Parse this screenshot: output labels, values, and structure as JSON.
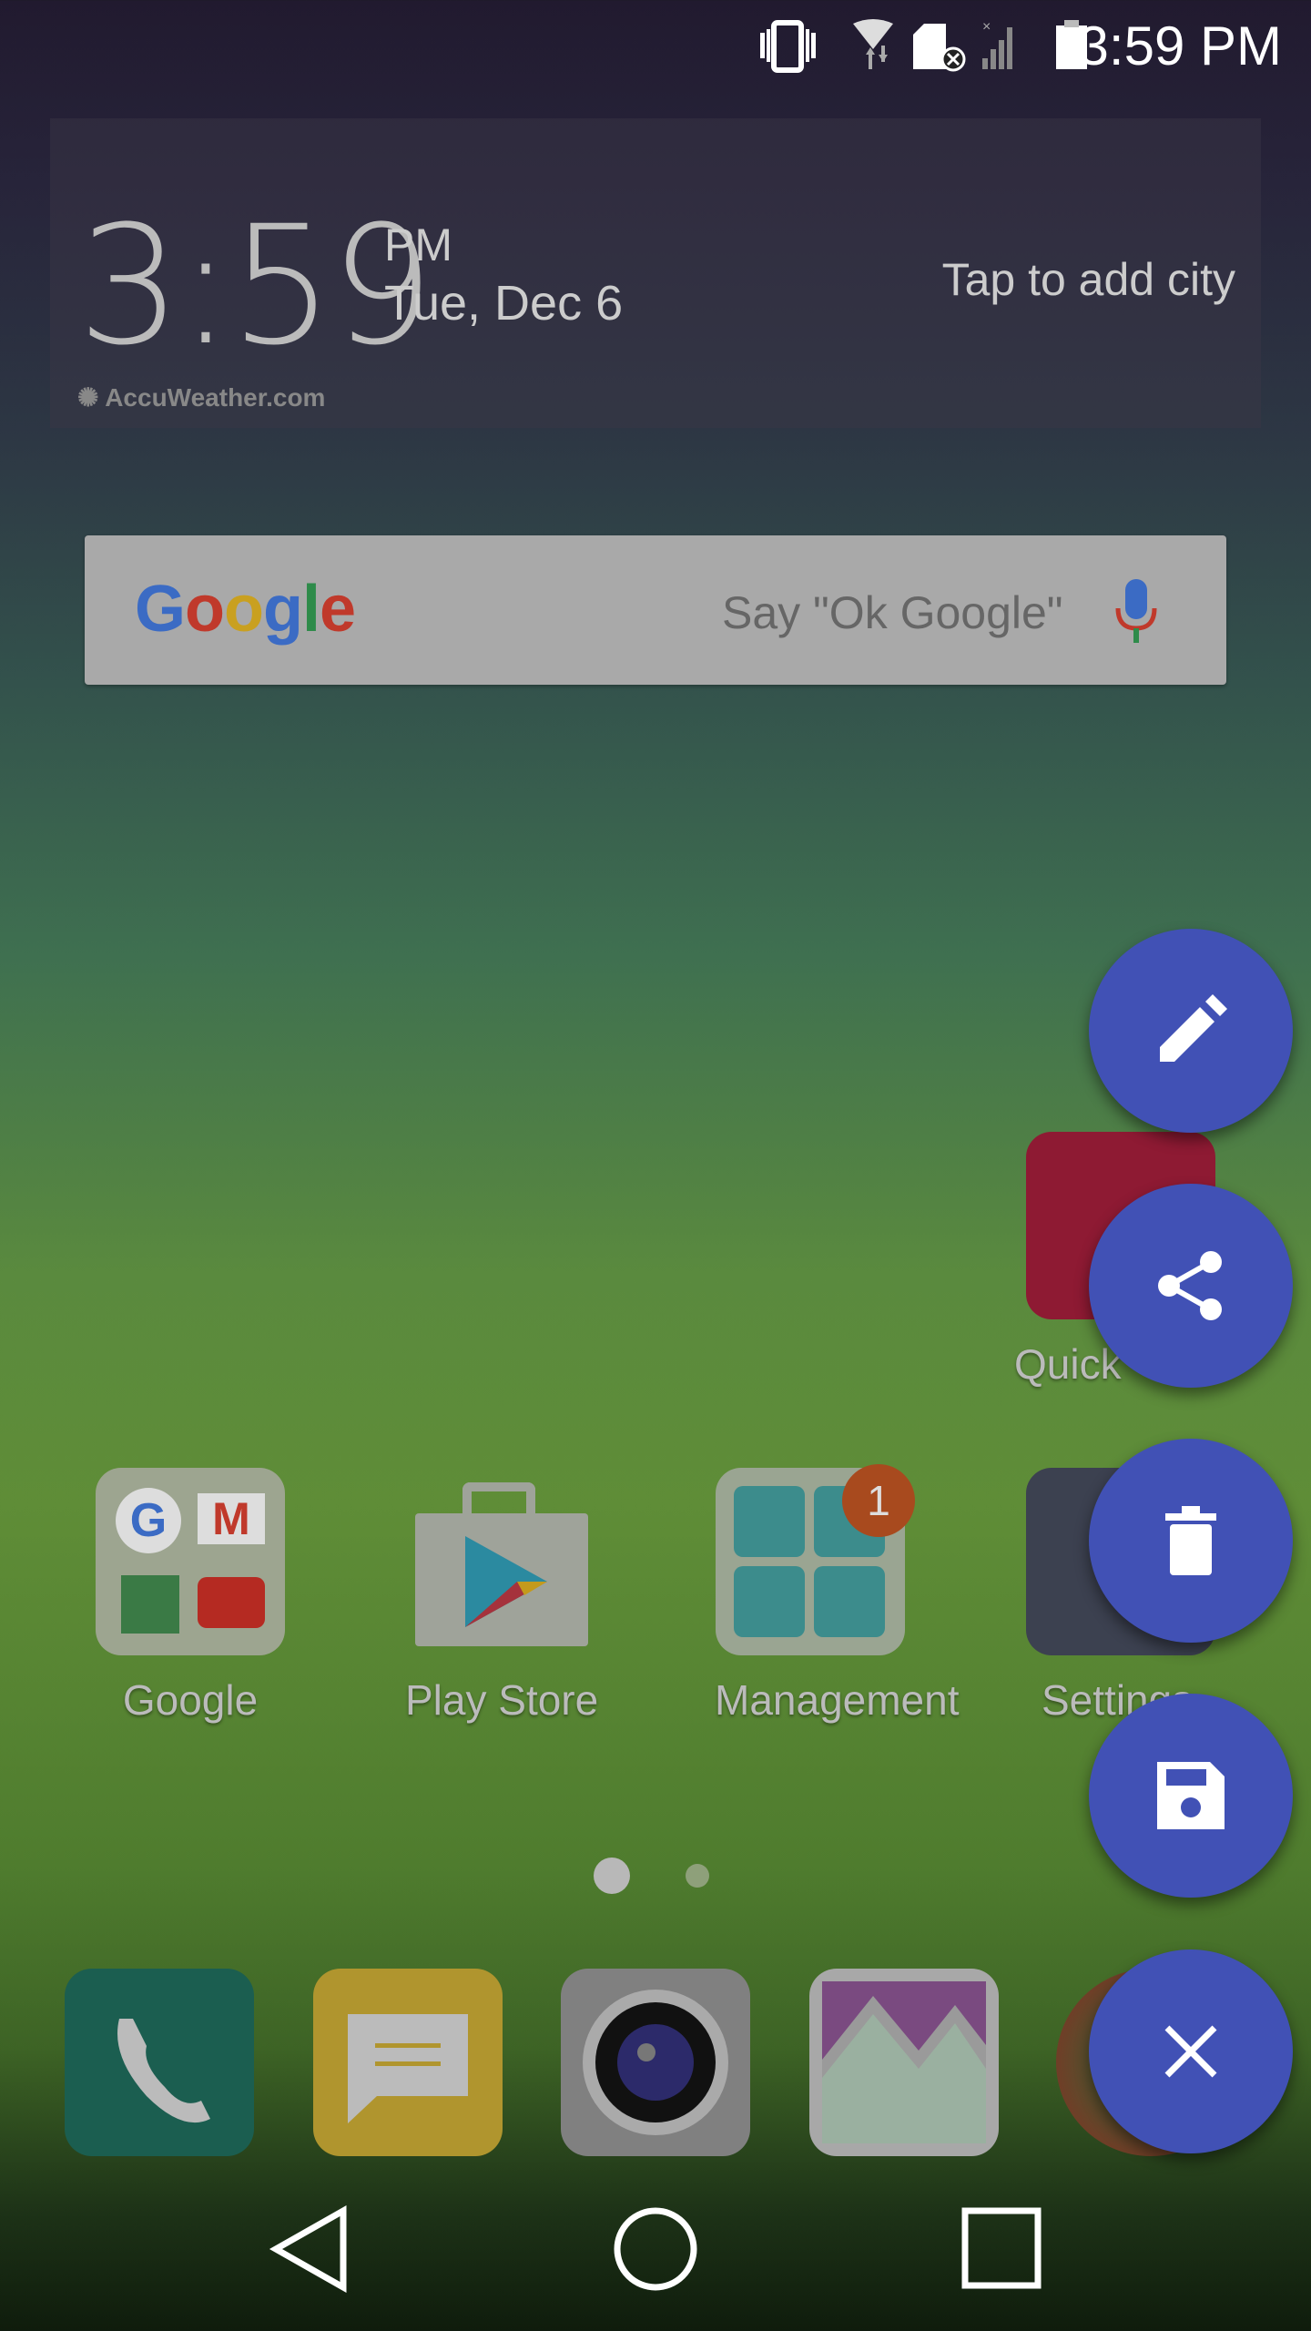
{
  "status_bar": {
    "time": "3:59 PM",
    "icons": [
      "vibrate-icon",
      "wifi-data-icon",
      "sd-card-error-icon",
      "signal-no-sim-icon",
      "battery-icon"
    ]
  },
  "clock_widget": {
    "time": "3:59",
    "ampm": "PM",
    "date": "Tue, Dec 6",
    "city_prompt": "Tap to add city",
    "provider": "AccuWeather.com"
  },
  "search": {
    "logo": "Google",
    "hint": "Say \"Ok Google\"",
    "brand_colors": {
      "blue": "#4285f4",
      "red": "#ea4335",
      "yellow": "#fbbc05",
      "green": "#34a853"
    }
  },
  "apps": [
    {
      "label": "Google"
    },
    {
      "label": "Play Store"
    },
    {
      "label": "Management",
      "badge": "1"
    },
    {
      "label": "Settings"
    }
  ],
  "quick_app": {
    "label": "Quick"
  },
  "page_indicator": {
    "pages": 2,
    "current": 1
  },
  "dock": [
    "phone-icon",
    "messages-icon",
    "camera-icon",
    "gallery-icon",
    "chrome-icon"
  ],
  "fab_menu": {
    "color": "#4151b5",
    "items": [
      "edit-icon",
      "share-icon",
      "delete-icon",
      "save-icon",
      "close-icon"
    ]
  },
  "nav_bar": [
    "back-icon",
    "home-icon",
    "recents-icon"
  ]
}
